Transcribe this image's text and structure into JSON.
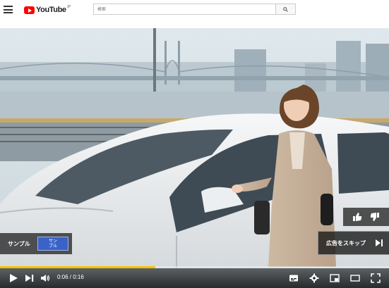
{
  "header": {
    "logo_text": "YouTube",
    "logo_region": "JP",
    "search_placeholder": "検索"
  },
  "player": {
    "ad_label": "サンプル",
    "ad_badge": "サン\nプル",
    "skip_label": "広告をスキップ",
    "time_display": "0:06 / 0:16",
    "progress": 0.4
  },
  "colors": {
    "brand": "#ff0000",
    "progress_fill": "#f4c400",
    "badge": "#3a63c8"
  },
  "icons": [
    "menu-icon",
    "search-icon",
    "thumbs-up-icon",
    "thumbs-down-icon",
    "skip-icon",
    "play-icon",
    "next-icon",
    "volume-icon",
    "subtitles-icon",
    "settings-icon",
    "miniplayer-icon",
    "theater-icon",
    "fullscreen-icon"
  ]
}
